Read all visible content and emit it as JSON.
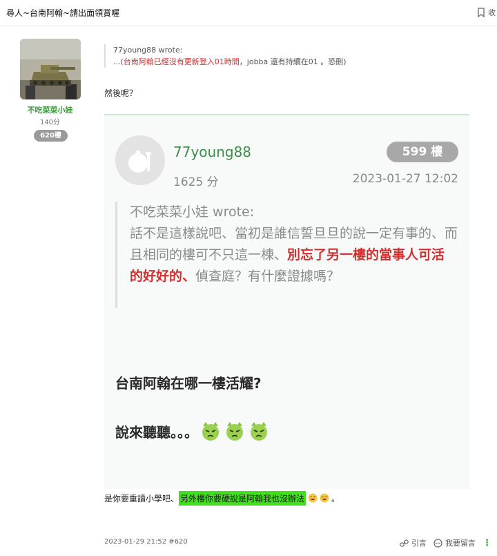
{
  "header": {
    "title": "尋人~台南阿翰~請出面領賞喔",
    "bookmark_label": "收"
  },
  "author": {
    "name": "不吃菜菜小娃",
    "points": "140分",
    "floor": "620樓"
  },
  "post": {
    "quote": {
      "author_line": "77young88 wrote:",
      "prefix": "...(",
      "red_text": "台南阿翰已經沒有更新登入01時間",
      "suffix": "，jobba 還有持續在01 。恐刪)"
    },
    "reply": "然後呢？",
    "embedded": {
      "name": "77young88",
      "points": "1625 分",
      "floor": "599 樓",
      "date": "2023-01-27 12:02",
      "quote": {
        "author_line": "不吃菜菜小娃 wrote:",
        "text_plain": "話不是這樣說吧、當初是誰信誓旦旦的說一定有事的、而且相同的樓可不只這一棟、",
        "text_red": "別忘了另一樓的當事人可活的好好的、",
        "text_plain2": "偵查庭？有什麼證據嗎？"
      },
      "line1": "台南阿翰在哪一樓活耀?",
      "line2": "說來聽聽。。。"
    },
    "final_text": "是你要重讀小學吧、",
    "highlight_text": "另外樓你要硬說是阿翰我也沒辦法",
    "final_suffix": "。"
  },
  "footer": {
    "meta": "2023-01-29 21:52 #620",
    "quote_action": "引言",
    "reply_action": "我要留言"
  }
}
